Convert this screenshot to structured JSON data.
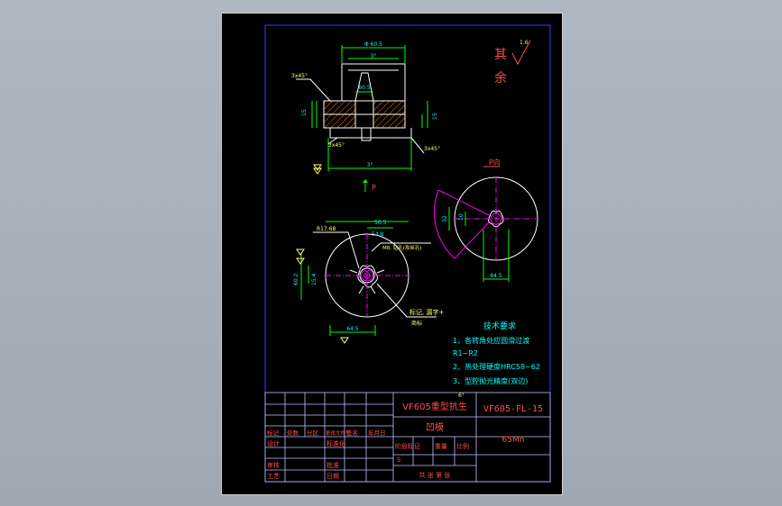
{
  "drawing": {
    "roughness_label": "其余",
    "roughness_value": "1.6",
    "view_label_p": "P",
    "view_title_p": "P向",
    "dims": {
      "top_width": "3°",
      "bottom_width": "3°",
      "chamfer_tl": "3x45°",
      "chamfer_bl": "3x45°",
      "chamfer_br": "3x45°",
      "dia_top": "Φ 60.5",
      "d_inner": "60.5",
      "h_left": "15",
      "h_right": "15",
      "r_label": "R17.68",
      "front_dim_1": "50.5",
      "front_dim_2": "54.8",
      "front_note": "M8, 钻孔(攻丝孔)",
      "mark_note": "标记, 漏字+",
      "mark_note2": "商标",
      "h_l1": "60.2",
      "h_l2": "15.4",
      "bottom_dim": "64.5",
      "pv_dim1": "32",
      "pv_dim2": "10",
      "pv_dim3": "64.5"
    }
  },
  "tech_requirements": {
    "title": "技术要求",
    "items": [
      "1、各转角处应圆滑过渡",
      "R1~R2",
      "2、热处理硬度HRC58~62",
      "3、型腔抛光精度(双边)"
    ]
  },
  "title_block": {
    "product": "VF605重型抗生",
    "part_name": "凹模",
    "drawing_no": "VF605-FL-15",
    "material": "65Mn",
    "row_labels": [
      "标记",
      "处数",
      "分区",
      "更改文件号",
      "签名",
      "年月日"
    ],
    "design": "设计",
    "standardize": "标准化",
    "review": "审核",
    "process": "工艺",
    "approve": "批准",
    "date": "日期",
    "stage": "阶段标记",
    "weight": "重量",
    "scale": "比例",
    "sheets": "共  张  第  张",
    "stage_s": "S",
    "angle": "6°"
  },
  "colors": {
    "frame": "#0000ff",
    "table": "#c0c0ff",
    "part": "#ffffff",
    "dim": "#00ff00",
    "note": "#ff00ff",
    "text": "#00ffff",
    "title": "#ff4d4d",
    "hatch": "#ff7f00",
    "yellow": "#ffff66"
  }
}
